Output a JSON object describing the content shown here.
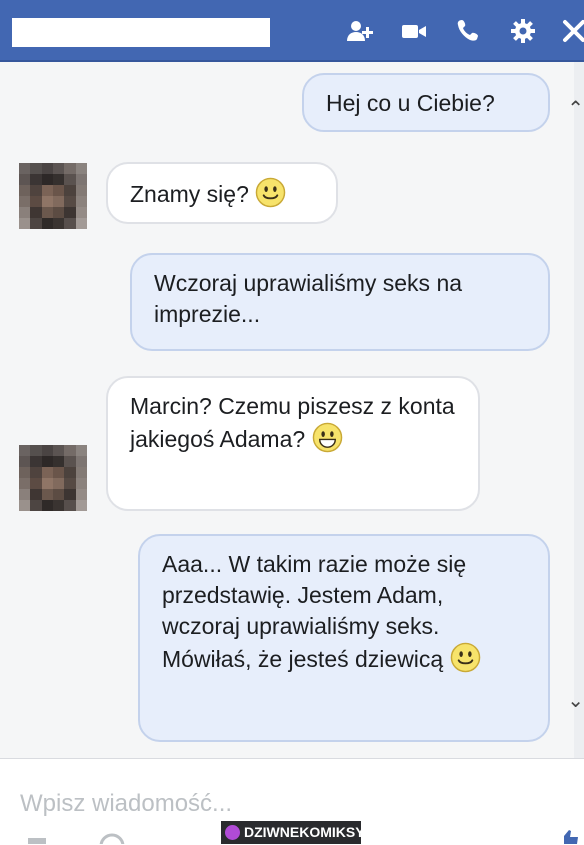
{
  "header": {
    "title": "",
    "icons": [
      "add-people-icon",
      "video-call-icon",
      "phone-call-icon",
      "gear-icon",
      "close-icon"
    ]
  },
  "messages": [
    {
      "direction": "outgoing",
      "text": "Hej co u Ciebie?",
      "emoji": ""
    },
    {
      "direction": "incoming",
      "text": "Znamy się?",
      "emoji": "smiley"
    },
    {
      "direction": "outgoing",
      "text": "Wczoraj uprawialiśmy seks na imprezie...",
      "emoji": ""
    },
    {
      "direction": "incoming",
      "text": "Marcin? Czemu piszesz z konta jakiegoś Adama?",
      "emoji": "smiley"
    },
    {
      "direction": "outgoing",
      "text": "Aaa... W takim razie może się przedstawię. Jestem Adam, wczoraj uprawialiśmy seks. Mówiłaś, że jesteś dziewicą",
      "emoji": "smiley"
    }
  ],
  "composer": {
    "placeholder": "Wpisz wiadomość...",
    "value": ""
  },
  "watermark": "DZIWNEKOMIKSY.PL",
  "colors": {
    "header_bg": "#4267b2",
    "outgoing_bubble": "#e7eefb",
    "incoming_bubble": "#ffffff"
  }
}
